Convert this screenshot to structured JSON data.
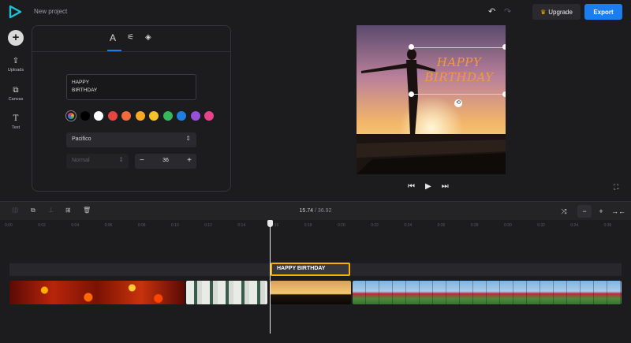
{
  "app": {
    "project_title": "New project"
  },
  "header": {
    "upgrade_label": "Upgrade",
    "export_label": "Export"
  },
  "sidebar": {
    "items": [
      {
        "label": "Uploads",
        "icon": "upload-icon"
      },
      {
        "label": "Canvas",
        "icon": "canvas-icon"
      },
      {
        "label": "Text",
        "icon": "text-icon"
      }
    ]
  },
  "text_panel": {
    "tabs": [
      {
        "icon": "text-style-icon",
        "active": true
      },
      {
        "icon": "adjust-icon"
      },
      {
        "icon": "fill-icon"
      }
    ],
    "text_value": "HAPPY\nBIRTHDAY",
    "colors": [
      "#000000",
      "#ffffff",
      "#e8453c",
      "#f26b3a",
      "#f9a826",
      "#f6c226",
      "#34b85a",
      "#1f7fe0",
      "#9a4fd8",
      "#e8428a"
    ],
    "font_family": "Pacifico",
    "font_weight": "Normal",
    "font_size": "36"
  },
  "preview": {
    "overlay_text": "HAPPY BIRTHDAY",
    "text_color": "#f39a3d"
  },
  "timeline": {
    "current_time": "15.74",
    "separator": "/",
    "total_time": "36.92",
    "ruler_ticks": [
      "0:00",
      "0:02",
      "0:04",
      "0:06",
      "0:08",
      "0:10",
      "0:12",
      "0:14",
      "0:16",
      "0:18",
      "0:20",
      "0:22",
      "0:24",
      "0:26",
      "0:28",
      "0:30",
      "0:32",
      "0:34",
      "0:36"
    ],
    "text_clip_label": "HAPPY BIRTHDAY"
  }
}
